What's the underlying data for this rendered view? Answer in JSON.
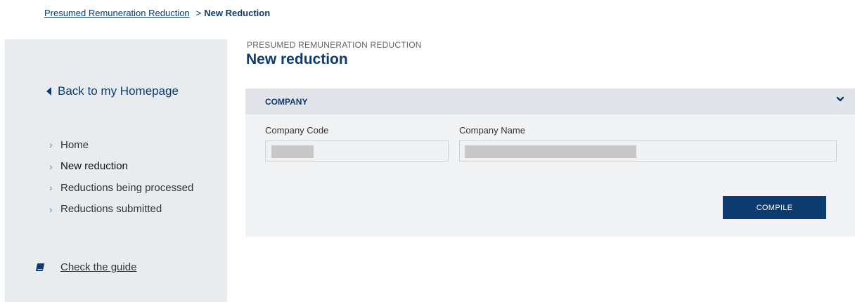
{
  "breadcrumb": {
    "parent": "Presumed Remuneration Reduction",
    "separator": ">",
    "current": "New Reduction"
  },
  "sidebar": {
    "back_label": "Back to my Homepage",
    "items": [
      {
        "label": "Home",
        "active": false
      },
      {
        "label": "New reduction",
        "active": true
      },
      {
        "label": "Reductions being processed",
        "active": false
      },
      {
        "label": "Reductions submitted",
        "active": false
      }
    ],
    "item_chevron": "›",
    "guide_label": "Check the guide",
    "guide_icon": "book-icon"
  },
  "main": {
    "section_label": "PRESUMED REMUNERATION REDUCTION",
    "title": "New reduction",
    "panel": {
      "title": "COMPANY",
      "toggle_icon": "chevron-down-icon",
      "fields": {
        "company_code_label": "Company Code",
        "company_code_value": "",
        "company_name_label": "Company Name",
        "company_name_value": ""
      },
      "compile_label": "COMPILE"
    }
  },
  "colors": {
    "brand_navy": "#0d3b6e",
    "accent_blue": "#4a90c9",
    "sidebar_bg": "#e9ecef",
    "panel_bg": "#f2f3f4",
    "panel_header_bg": "#e1e4e8"
  }
}
